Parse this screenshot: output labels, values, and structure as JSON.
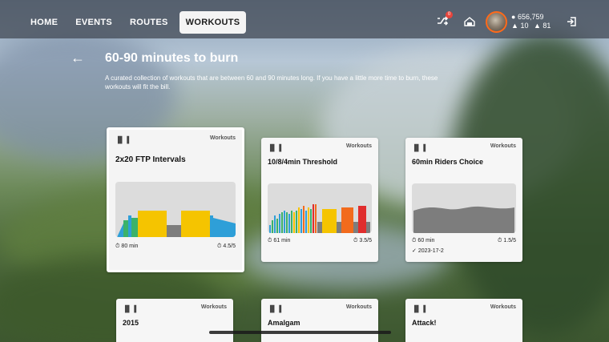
{
  "nav": {
    "items": [
      {
        "label": "HOME",
        "active": false
      },
      {
        "label": "EVENTS",
        "active": false
      },
      {
        "label": "ROUTES",
        "active": false
      },
      {
        "label": "WORKOUTS",
        "active": true
      }
    ]
  },
  "topbar": {
    "notification_badge": "0",
    "drops": "656,759",
    "level": "10",
    "streak": "81",
    "icons": [
      "drops-icon",
      "level-icon",
      "streak-icon",
      "shuffle-icon",
      "garage-icon",
      "logout-icon"
    ]
  },
  "header": {
    "title": "60-90 minutes to burn",
    "description": "A curated collection of workouts that are between 60 and 90 minutes long. If you have a little more time to burn, these workouts will fit the bill."
  },
  "cards": [
    {
      "category": "Workouts",
      "title": "2x20 FTP Intervals",
      "duration": "80 min",
      "difficulty": "4.5/5",
      "date": "",
      "selected": true,
      "chart": "ftp"
    },
    {
      "category": "Workouts",
      "title": "10/8/4min Threshold",
      "duration": "61 min",
      "difficulty": "3.5/5",
      "date": "",
      "selected": false,
      "chart": "threshold"
    },
    {
      "category": "Workouts",
      "title": "60min Riders Choice",
      "duration": "60 min",
      "difficulty": "1.5/5",
      "date": "2023-17-2",
      "selected": false,
      "chart": "riders"
    },
    {
      "category": "Workouts",
      "title": "2015"
    },
    {
      "category": "Workouts",
      "title": "Amalgam"
    },
    {
      "category": "Workouts",
      "title": "Attack!"
    }
  ],
  "colors": {
    "zone_blue": "#2e9fd8",
    "zone_green": "#3bb26a",
    "zone_yellow": "#f5c400",
    "zone_orange": "#f26b1d",
    "zone_red": "#e02d2d",
    "zone_gray": "#7d7d7d",
    "avatar_ring": "#ff6a1a"
  }
}
